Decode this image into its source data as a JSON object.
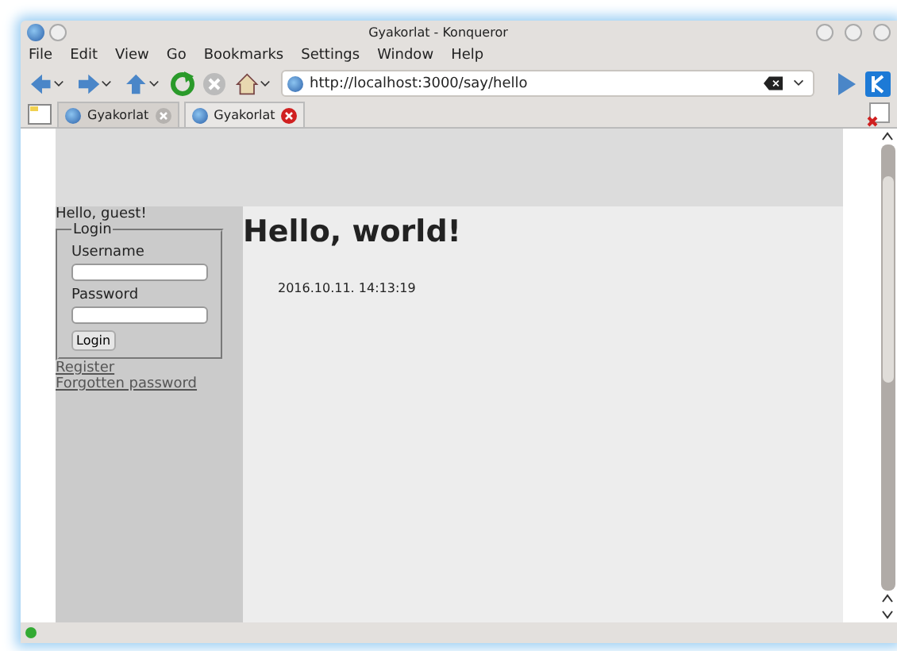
{
  "window": {
    "title": "Gyakorlat - Konqueror"
  },
  "menu": [
    "File",
    "Edit",
    "View",
    "Go",
    "Bookmarks",
    "Settings",
    "Window",
    "Help"
  ],
  "address": {
    "value": "http://localhost:3000/say/hello"
  },
  "tabs": [
    {
      "label": "Gyakorlat",
      "selected": false
    },
    {
      "label": "Gyakorlat",
      "selected": true
    }
  ],
  "page": {
    "greeting": "Hello, guest!",
    "login": {
      "legend": "Login",
      "fields": [
        {
          "label": "Username"
        },
        {
          "label": "Password"
        }
      ],
      "button": "Login"
    },
    "links": [
      "Register",
      "Forgotten password"
    ],
    "heading": "Hello, world!",
    "timestamp": "2016.10.11. 14:13:19"
  }
}
